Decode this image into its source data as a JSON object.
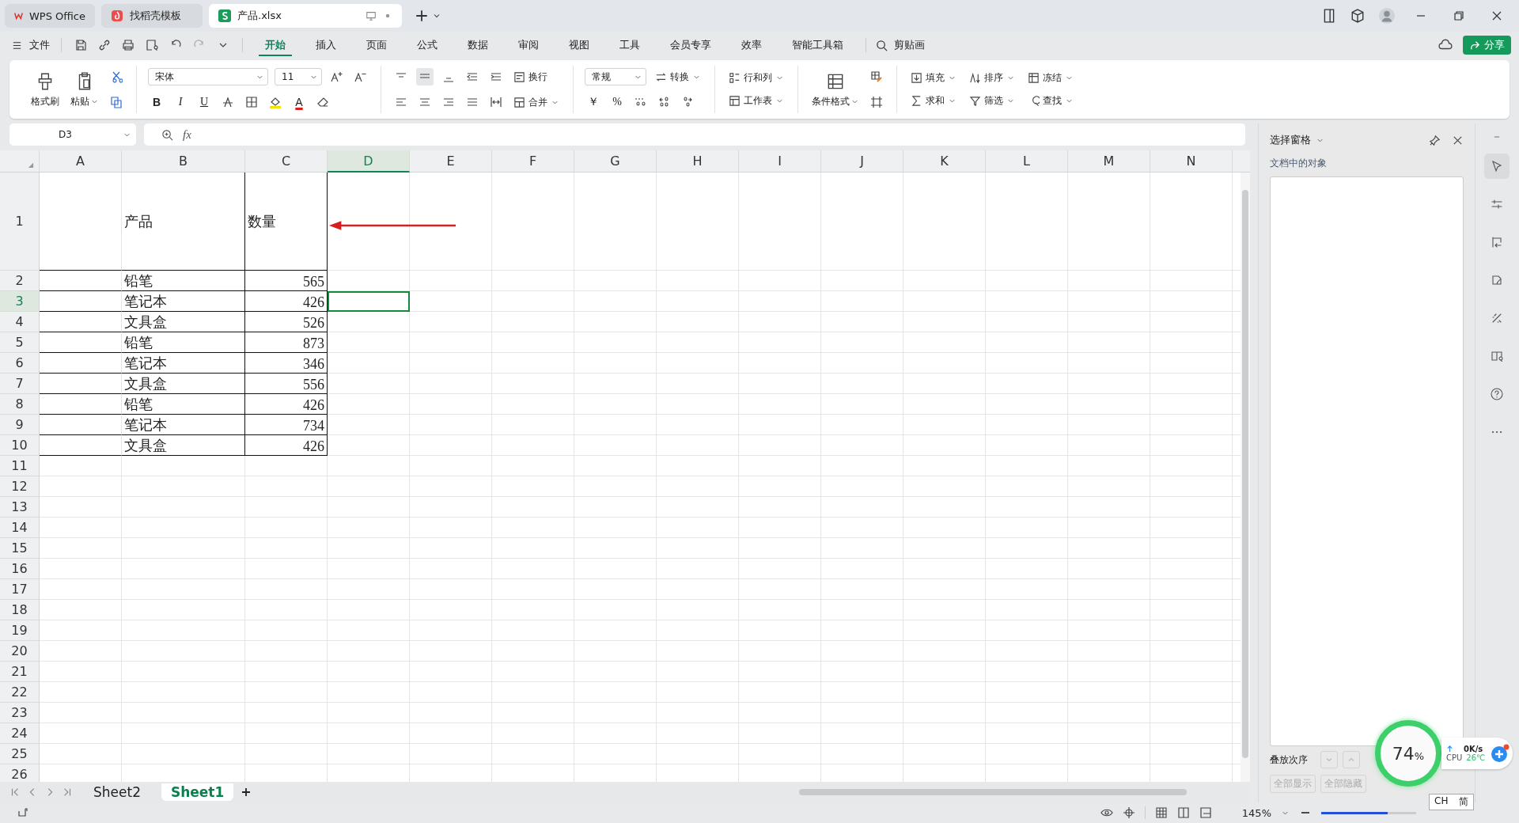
{
  "tabs": [
    {
      "label": "WPS Office",
      "kind": "home",
      "selected": false
    },
    {
      "label": "找稻壳模板",
      "kind": "template",
      "selected": false
    },
    {
      "label": "产品.xlsx",
      "kind": "sheet",
      "selected": true
    }
  ],
  "menu": {
    "file": "文件",
    "tabs": [
      {
        "label": "开始",
        "selected": true
      },
      {
        "label": "插入",
        "selected": false
      },
      {
        "label": "页面",
        "selected": false
      },
      {
        "label": "公式",
        "selected": false
      },
      {
        "label": "数据",
        "selected": false
      },
      {
        "label": "审阅",
        "selected": false
      },
      {
        "label": "视图",
        "selected": false
      },
      {
        "label": "工具",
        "selected": false
      },
      {
        "label": "会员专享",
        "selected": false
      },
      {
        "label": "效率",
        "selected": false
      },
      {
        "label": "智能工具箱",
        "selected": false
      }
    ],
    "search": "剪贴画",
    "share": "分享"
  },
  "ribbon": {
    "format_painter": "格式刷",
    "paste": "粘贴",
    "font_name": "宋体",
    "font_size": "11",
    "bold": "B",
    "italic": "I",
    "underline": "U",
    "font_color": "A",
    "wrap": "换行",
    "merge": "合并",
    "number_format": "常规",
    "convert": "转换",
    "currency": "￥",
    "percent": "%",
    "rows_cols": "行和列",
    "worksheet": "工作表",
    "conditional": "条件格式",
    "edit": [
      {
        "label": "填充"
      },
      {
        "label": "排序"
      },
      {
        "label": "冻结"
      },
      {
        "label": "求和"
      },
      {
        "label": "筛选"
      },
      {
        "label": "查找"
      }
    ]
  },
  "formula_bar": {
    "name_box": "D3",
    "fx": "fx"
  },
  "sheet": {
    "columns": [
      {
        "label": "A",
        "selected": false
      },
      {
        "label": "B",
        "selected": false
      },
      {
        "label": "C",
        "selected": false
      },
      {
        "label": "D",
        "selected": true
      },
      {
        "label": "E",
        "selected": false
      },
      {
        "label": "F",
        "selected": false
      },
      {
        "label": "G",
        "selected": false
      },
      {
        "label": "H",
        "selected": false
      },
      {
        "label": "I",
        "selected": false
      },
      {
        "label": "J",
        "selected": false
      },
      {
        "label": "K",
        "selected": false
      },
      {
        "label": "L",
        "selected": false
      },
      {
        "label": "M",
        "selected": false
      },
      {
        "label": "N",
        "selected": false
      }
    ],
    "rows": [
      {
        "label": "1",
        "selected": false,
        "product": "产品",
        "quantity": "数量"
      },
      {
        "label": "2",
        "selected": false,
        "product": "铅笔",
        "quantity": "565"
      },
      {
        "label": "3",
        "selected": true,
        "product": "笔记本",
        "quantity": "426"
      },
      {
        "label": "4",
        "selected": false,
        "product": "文具盒",
        "quantity": "526"
      },
      {
        "label": "5",
        "selected": false,
        "product": "铅笔",
        "quantity": "873"
      },
      {
        "label": "6",
        "selected": false,
        "product": "笔记本",
        "quantity": "346"
      },
      {
        "label": "7",
        "selected": false,
        "product": "文具盒",
        "quantity": "556"
      },
      {
        "label": "8",
        "selected": false,
        "product": "铅笔",
        "quantity": "426"
      },
      {
        "label": "9",
        "selected": false,
        "product": "笔记本",
        "quantity": "734"
      },
      {
        "label": "10",
        "selected": false,
        "product": "文具盒",
        "quantity": "426"
      },
      {
        "label": "11",
        "selected": false
      },
      {
        "label": "12",
        "selected": false
      },
      {
        "label": "13",
        "selected": false
      },
      {
        "label": "14",
        "selected": false
      },
      {
        "label": "15",
        "selected": false
      },
      {
        "label": "16",
        "selected": false
      },
      {
        "label": "17",
        "selected": false
      },
      {
        "label": "18",
        "selected": false
      },
      {
        "label": "19",
        "selected": false
      },
      {
        "label": "20",
        "selected": false
      },
      {
        "label": "21",
        "selected": false
      },
      {
        "label": "22",
        "selected": false
      },
      {
        "label": "23",
        "selected": false
      },
      {
        "label": "24",
        "selected": false
      },
      {
        "label": "25",
        "selected": false
      },
      {
        "label": "26",
        "selected": false
      }
    ]
  },
  "sheet_tabs": [
    {
      "label": "Sheet2",
      "selected": false
    },
    {
      "label": "Sheet1",
      "selected": true
    }
  ],
  "selection_pane": {
    "title": "选择窗格",
    "subtitle": "文档中的对象",
    "order_label": "叠放次序",
    "show_all": "全部显示",
    "hide_all": "全部隐藏"
  },
  "status_bar": {
    "zoom": "145%",
    "zoom_slider": {
      "level": 0.7
    }
  },
  "monitor": {
    "memory": "74",
    "unit": "%",
    "speed": "0K/s",
    "cpu_label": "CPU",
    "temp": "26℃"
  },
  "ime": {
    "lang": "CH",
    "mode": "简"
  }
}
